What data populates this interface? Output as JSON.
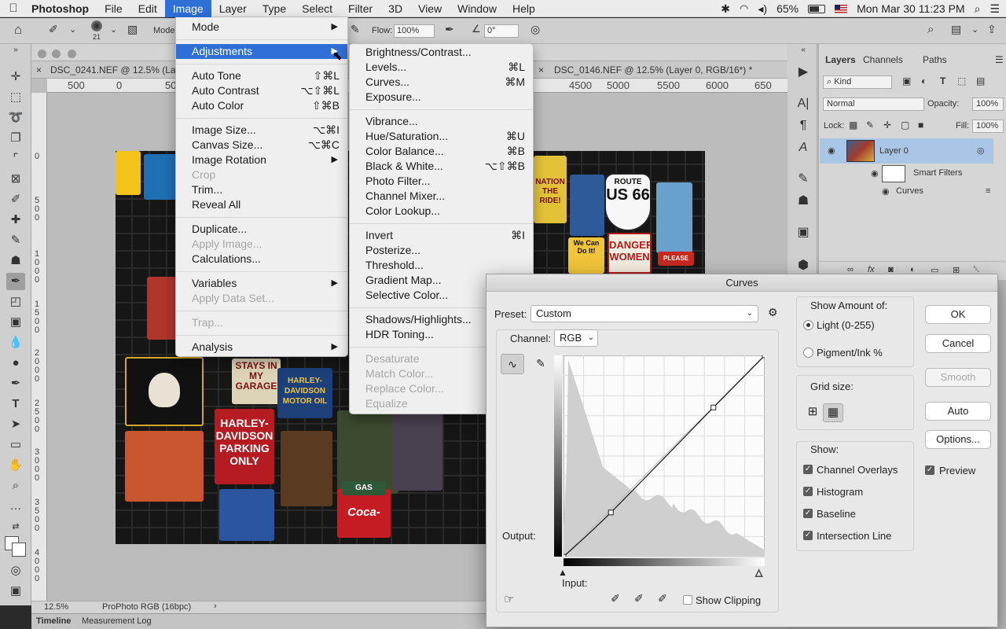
{
  "menubar": {
    "app": "Photoshop",
    "items": [
      "File",
      "Edit",
      "Image",
      "Layer",
      "Type",
      "Select",
      "Filter",
      "3D",
      "View",
      "Window",
      "Help"
    ],
    "battery": "65%",
    "datetime": "Mon Mar 30  11:23 PM"
  },
  "optionsbar": {
    "brush_size": "21",
    "mode_label": "Mode",
    "flow_label": "Flow:",
    "flow_value": "100%",
    "angle_value": "0°"
  },
  "document": {
    "tabs": [
      "DSC_0241.NEF @ 12.5% (Lay",
      "DSC_0146.NEF @ 12.5% (Layer 0, RGB/16*) *"
    ],
    "hruler": [
      "500",
      "0",
      "50",
      "4500",
      "5000",
      "5500",
      "6000",
      "650"
    ],
    "vruler": [
      "0",
      "5 0 0",
      "1 0 0 0",
      "1 5 0 0",
      "2 0 0 0",
      "2 5 0 0",
      "3 0 0 0",
      "3 5 0 0",
      "4 0 0 0"
    ],
    "zoom": "12.5%",
    "profile": "ProPhoto RGB (16bpc)",
    "bottom_tabs": [
      "Timeline",
      "Measurement Log"
    ]
  },
  "photo_signs": {
    "stays": "STAYS IN MY GARAGE",
    "hd_parking": "HARLEY- DAVIDSON PARKING ONLY",
    "motor_oil": "HARLEY-DAVIDSON MOTOR OIL",
    "route": "ROUTE",
    "us66": "US 66",
    "danger": "DANGER WOMEN",
    "gas": "GAS TODAY",
    "coke": "Coca-Cola",
    "wecan": "We Can Do It!",
    "nation": "NATION THE RIDE!",
    "please": "PLEASE"
  },
  "image_menu": [
    {
      "label": "Mode",
      "submenu": true
    },
    {
      "sep": true
    },
    {
      "label": "Adjustments",
      "submenu": true,
      "highlight": true
    },
    {
      "sep": true
    },
    {
      "label": "Auto Tone",
      "shortcut": "⇧⌘L"
    },
    {
      "label": "Auto Contrast",
      "shortcut": "⌥⇧⌘L"
    },
    {
      "label": "Auto Color",
      "shortcut": "⇧⌘B"
    },
    {
      "sep": true
    },
    {
      "label": "Image Size...",
      "shortcut": "⌥⌘I"
    },
    {
      "label": "Canvas Size...",
      "shortcut": "⌥⌘C"
    },
    {
      "label": "Image Rotation",
      "submenu": true
    },
    {
      "label": "Crop",
      "disabled": true
    },
    {
      "label": "Trim..."
    },
    {
      "label": "Reveal All"
    },
    {
      "sep": true
    },
    {
      "label": "Duplicate..."
    },
    {
      "label": "Apply Image...",
      "disabled": true
    },
    {
      "label": "Calculations..."
    },
    {
      "sep": true
    },
    {
      "label": "Variables",
      "submenu": true
    },
    {
      "label": "Apply Data Set...",
      "disabled": true
    },
    {
      "sep": true
    },
    {
      "label": "Trap...",
      "disabled": true
    },
    {
      "sep": true
    },
    {
      "label": "Analysis",
      "submenu": true
    }
  ],
  "adjustments_menu": [
    {
      "label": "Brightness/Contrast..."
    },
    {
      "label": "Levels...",
      "shortcut": "⌘L"
    },
    {
      "label": "Curves...",
      "shortcut": "⌘M"
    },
    {
      "label": "Exposure..."
    },
    {
      "sep": true
    },
    {
      "label": "Vibrance..."
    },
    {
      "label": "Hue/Saturation...",
      "shortcut": "⌘U"
    },
    {
      "label": "Color Balance...",
      "shortcut": "⌘B"
    },
    {
      "label": "Black & White...",
      "shortcut": "⌥⇧⌘B"
    },
    {
      "label": "Photo Filter..."
    },
    {
      "label": "Channel Mixer..."
    },
    {
      "label": "Color Lookup..."
    },
    {
      "sep": true
    },
    {
      "label": "Invert",
      "shortcut": "⌘I"
    },
    {
      "label": "Posterize..."
    },
    {
      "label": "Threshold..."
    },
    {
      "label": "Gradient Map..."
    },
    {
      "label": "Selective Color..."
    },
    {
      "sep": true
    },
    {
      "label": "Shadows/Highlights..."
    },
    {
      "label": "HDR Toning..."
    },
    {
      "sep": true
    },
    {
      "label": "Desaturate",
      "disabled": true
    },
    {
      "label": "Match Color...",
      "disabled": true
    },
    {
      "label": "Replace Color...",
      "disabled": true
    },
    {
      "label": "Equalize",
      "disabled": true
    }
  ],
  "layers_panel": {
    "tabs": [
      "Layers",
      "Channels",
      "Paths"
    ],
    "filter": "Kind",
    "blend_mode": "Normal",
    "opacity_label": "Opacity:",
    "opacity": "100%",
    "lock_label": "Lock:",
    "fill_label": "Fill:",
    "fill": "100%",
    "layer_name": "Layer 0",
    "smart_filters": "Smart Filters",
    "filter_name": "Curves"
  },
  "curves": {
    "title": "Curves",
    "preset_label": "Preset:",
    "preset_value": "Custom",
    "channel_label": "Channel:",
    "channel_value": "RGB",
    "output_label": "Output:",
    "input_label": "Input:",
    "show_clipping": "Show Clipping",
    "show_amount_title": "Show Amount of:",
    "light": "Light  (0-255)",
    "pigment": "Pigment/Ink %",
    "grid_size": "Grid size:",
    "show_title": "Show:",
    "channel_overlays": "Channel Overlays",
    "histogram": "Histogram",
    "baseline": "Baseline",
    "intersection": "Intersection Line",
    "preview": "Preview",
    "buttons": {
      "ok": "OK",
      "cancel": "Cancel",
      "smooth": "Smooth",
      "auto": "Auto",
      "options": "Options..."
    },
    "points": [
      [
        0,
        0
      ],
      [
        60,
        56
      ],
      [
        190,
        189
      ],
      [
        255,
        255
      ]
    ]
  },
  "colors": {
    "accent": "#2f6fd8",
    "layer_selected": "#a9c6e6"
  }
}
